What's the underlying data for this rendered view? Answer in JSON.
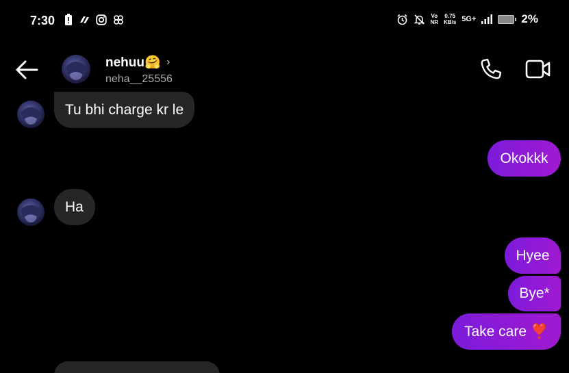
{
  "status_bar": {
    "time": "7:30",
    "net_speed_value": "0.75",
    "net_speed_unit": "KB/s",
    "network_type": "5G+",
    "volte_top": "Vo",
    "volte_bottom": "NR",
    "battery_percent": "2%",
    "icons_left": [
      "battery-alert-icon",
      "app-notification-icon",
      "instagram-icon",
      "app-icon"
    ],
    "icons_right": [
      "alarm-icon",
      "mute-icon",
      "volte-icon",
      "net-speed",
      "network-icon",
      "signal-icon",
      "battery-icon"
    ]
  },
  "header": {
    "name": "nehuu🤗",
    "username": "neha__25556",
    "chevron": "›"
  },
  "messages": [
    {
      "direction": "incoming",
      "text": "Tu bhi charge kr le"
    },
    {
      "direction": "outgoing",
      "text": "Okokkk"
    },
    {
      "direction": "incoming",
      "text": "Ha"
    },
    {
      "direction": "outgoing",
      "text": "Hyee"
    },
    {
      "direction": "outgoing",
      "text": "Bye*"
    },
    {
      "direction": "outgoing",
      "text": "Take care ❣️"
    }
  ],
  "colors": {
    "background": "#000000",
    "incoming_bubble": "#262626",
    "outgoing_start": "#7c1bdb",
    "outgoing_end": "#a01ad0"
  }
}
